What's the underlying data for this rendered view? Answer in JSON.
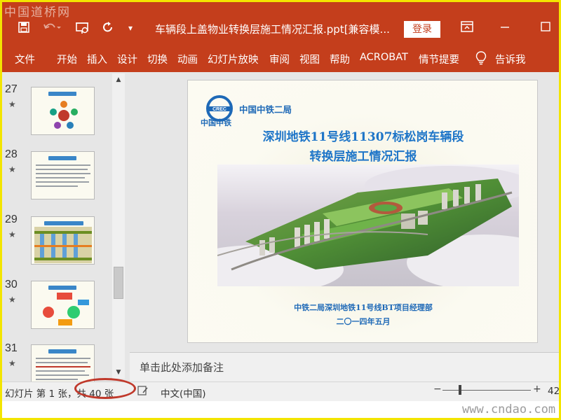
{
  "watermark": {
    "top": "中国道桥网",
    "bottom": "www.cndao.com"
  },
  "titlebar": {
    "icons": [
      "save-icon",
      "undo-icon",
      "present-from-start-icon",
      "redo-icon",
      "customize-qat-icon",
      "ribbon-display-icon",
      "maximize-icon"
    ],
    "document_title": "车辆段上盖物业转换层施工情况汇报.ppt[兼容模...",
    "login_label": "登录",
    "accent_color": "#c43e1c"
  },
  "ribbon": {
    "tabs": [
      "文件",
      "开始",
      "插入",
      "设计",
      "切换",
      "动画",
      "幻灯片放映",
      "审阅",
      "视图",
      "帮助",
      "ACROBAT",
      "情节提要"
    ],
    "tell_me": "告诉我"
  },
  "thumbnails": [
    {
      "number": "27",
      "star": "★"
    },
    {
      "number": "28",
      "star": "★"
    },
    {
      "number": "29",
      "star": "★"
    },
    {
      "number": "30",
      "star": "★"
    },
    {
      "number": "31",
      "star": "★"
    }
  ],
  "slide": {
    "org_name": "中国中铁二局",
    "logo_text": "中国中铁",
    "logo_abbrev": "CREC",
    "title_line1": "深圳地铁11号线11307标松岗车辆段",
    "title_line2": "转换层施工情况汇报",
    "footer_line1": "中铁二局深圳地铁11号线BT项目经理部",
    "footer_line2": "二〇一四年五月",
    "title_color": "#1e75c8"
  },
  "notes": {
    "placeholder": "单击此处添加备注"
  },
  "statusbar": {
    "slide_indicator": "幻灯片 第 1 张，共 40 张",
    "language": "中文(中国)",
    "zoom": "42",
    "highlight_color": "#c0392b"
  }
}
